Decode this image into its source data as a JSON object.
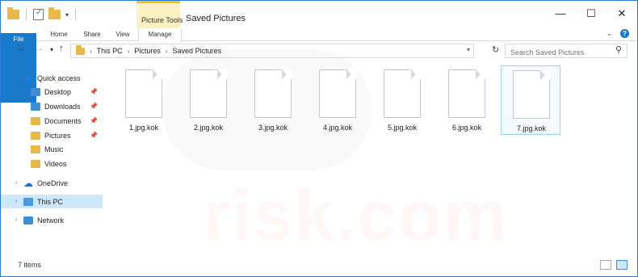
{
  "window": {
    "title": "Saved Pictures",
    "context_tab_label": "Picture Tools"
  },
  "ribbon": {
    "tabs": [
      "File",
      "Home",
      "Share",
      "View",
      "Manage"
    ]
  },
  "address": {
    "crumbs": [
      "This PC",
      "Pictures",
      "Saved Pictures"
    ],
    "search_placeholder": "Search Saved Pictures"
  },
  "sidebar": {
    "quick_access": "Quick access",
    "items": [
      {
        "label": "Desktop"
      },
      {
        "label": "Downloads"
      },
      {
        "label": "Documents"
      },
      {
        "label": "Pictures"
      },
      {
        "label": "Music"
      },
      {
        "label": "Videos"
      }
    ],
    "onedrive": "OneDrive",
    "this_pc": "This PC",
    "network": "Network"
  },
  "files": [
    "1.jpg.kok",
    "2.jpg.kok",
    "3.jpg.kok",
    "4.jpg.kok",
    "5.jpg.kok",
    "6.jpg.kok",
    "7.jpg.kok"
  ],
  "status": {
    "count_text": "7 items"
  },
  "watermark": "risk.com",
  "colors": {
    "accent": "#1979ca",
    "selection": "#cce8ff",
    "context_tab": "#fbf2c4"
  }
}
